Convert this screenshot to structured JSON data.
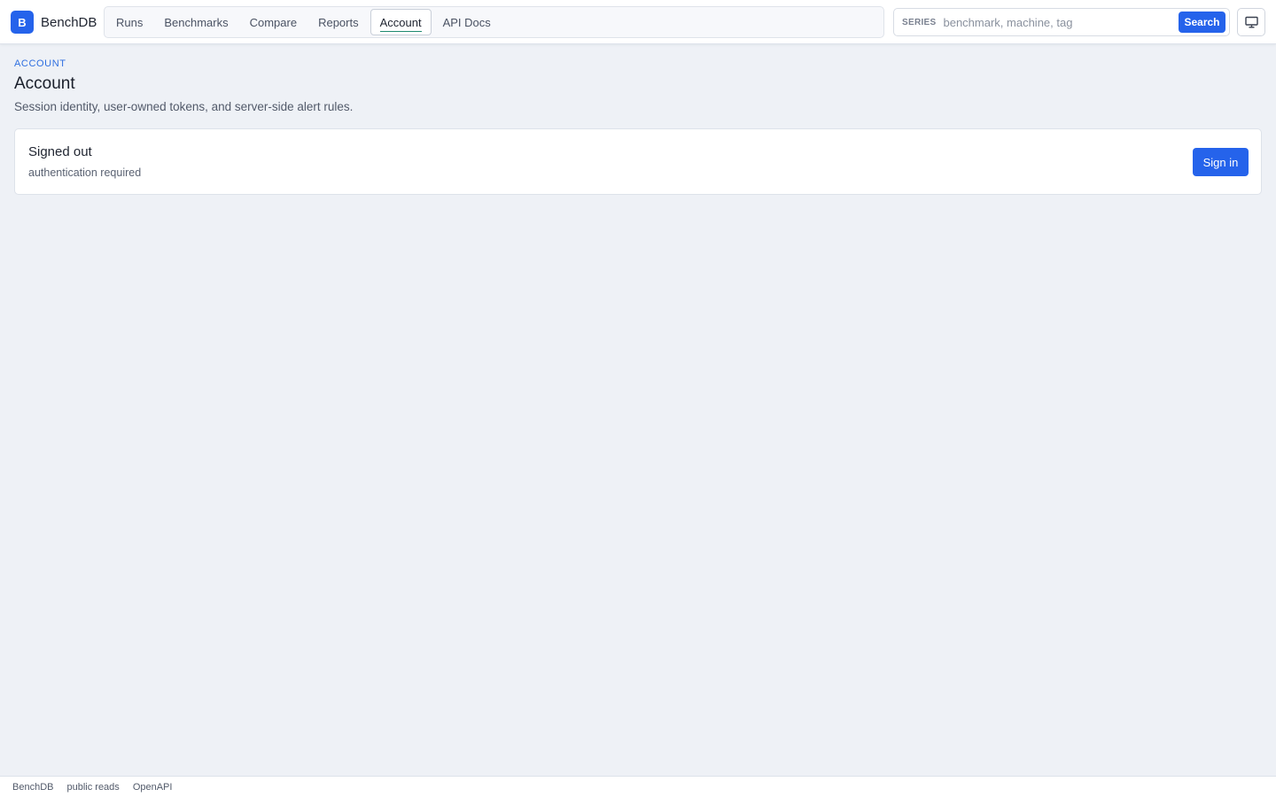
{
  "brand": {
    "logo_letter": "B",
    "name": "BenchDB"
  },
  "nav": {
    "items": [
      {
        "label": "Runs"
      },
      {
        "label": "Benchmarks"
      },
      {
        "label": "Compare"
      },
      {
        "label": "Reports"
      },
      {
        "label": "Account",
        "active": true
      },
      {
        "label": "API Docs"
      }
    ]
  },
  "search": {
    "label": "SERIES",
    "placeholder": "benchmark, machine, tag",
    "value": "",
    "button_label": "Search"
  },
  "header": {
    "breadcrumb": "ACCOUNT",
    "title": "Account",
    "description": "Session identity, user-owned tokens, and server-side alert rules."
  },
  "auth_card": {
    "title": "Signed out",
    "subtitle": "authentication required",
    "button_label": "Sign in"
  },
  "footer": {
    "links": [
      "BenchDB",
      "public reads",
      "OpenAPI"
    ]
  },
  "colors": {
    "accent": "#2563eb",
    "background": "#eef1f6",
    "active_underline": "#1f8a70"
  },
  "icons": {
    "display_toggle": "monitor-icon"
  }
}
